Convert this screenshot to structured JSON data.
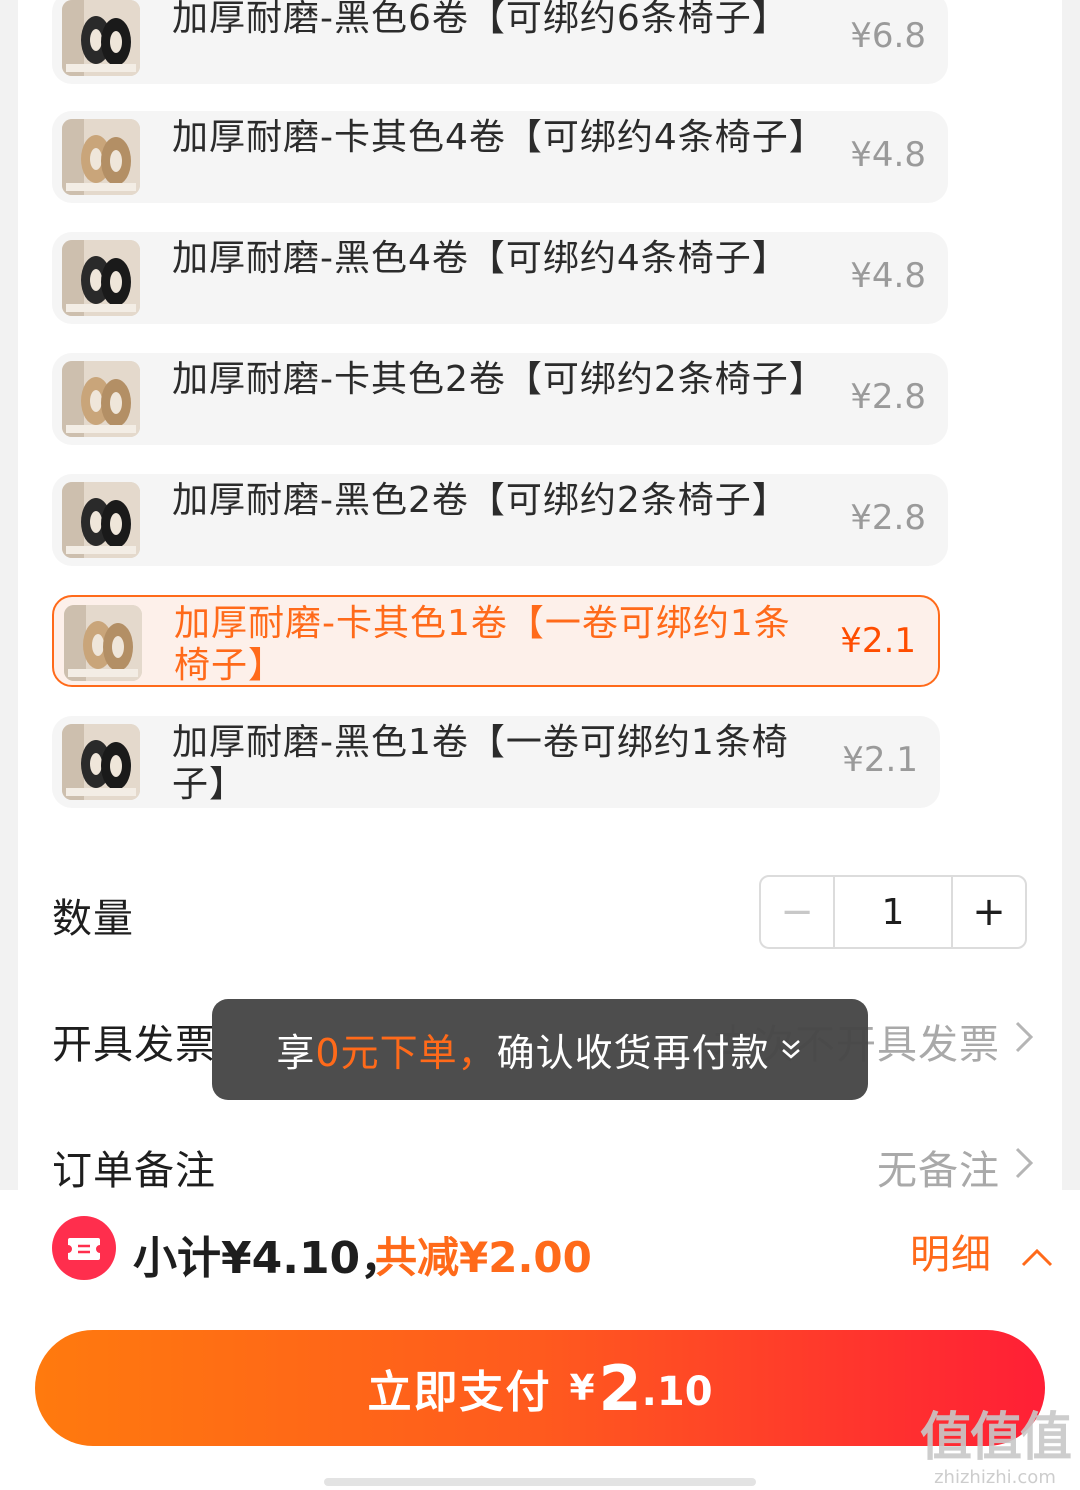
{
  "skus": [
    {
      "name": "加厚耐磨-黑色6卷【可绑约6条椅子】",
      "price": "¥6.8",
      "color": "black",
      "selected": false
    },
    {
      "name": "加厚耐磨-卡其色4卷【可绑约4条椅子】",
      "price": "¥4.8",
      "color": "khaki",
      "selected": false
    },
    {
      "name": "加厚耐磨-黑色4卷【可绑约4条椅子】",
      "price": "¥4.8",
      "color": "black",
      "selected": false
    },
    {
      "name": "加厚耐磨-卡其色2卷【可绑约2条椅子】",
      "price": "¥2.8",
      "color": "khaki",
      "selected": false
    },
    {
      "name": "加厚耐磨-黑色2卷【可绑约2条椅子】",
      "price": "¥2.8",
      "color": "black",
      "selected": false
    },
    {
      "name": "加厚耐磨-卡其色1卷【一卷可绑约1条椅子】",
      "price": "¥2.1",
      "color": "khaki",
      "selected": true
    },
    {
      "name": "加厚耐磨-黑色1卷【一卷可绑约1条椅子】",
      "price": "¥2.1",
      "color": "black",
      "selected": false
    }
  ],
  "quantity": {
    "label": "数量",
    "minus": "−",
    "value": "1",
    "plus": "+"
  },
  "invoice": {
    "label": "开具发票",
    "value": "本次不开具发票"
  },
  "remark": {
    "label": "订单备注",
    "value": "无备注"
  },
  "toast": {
    "prefix": "享",
    "highlight": "0元下单，",
    "suffix": "确认收货再付款"
  },
  "summary": {
    "subtotal": "小计¥4.10，",
    "discount": "共减¥2.00",
    "detail_label": "明细"
  },
  "pay_button": {
    "label": "立即支付",
    "currency": "¥",
    "amount_int": "2",
    "amount_dec": ".10"
  },
  "watermark": {
    "logo": "值值值",
    "url": "zhizhizhi.com"
  },
  "colors": {
    "accent": "#ff6a1a",
    "pay_start": "#ff7a0e",
    "pay_end": "#ff1f36",
    "coupon": "#ff2e4d"
  }
}
